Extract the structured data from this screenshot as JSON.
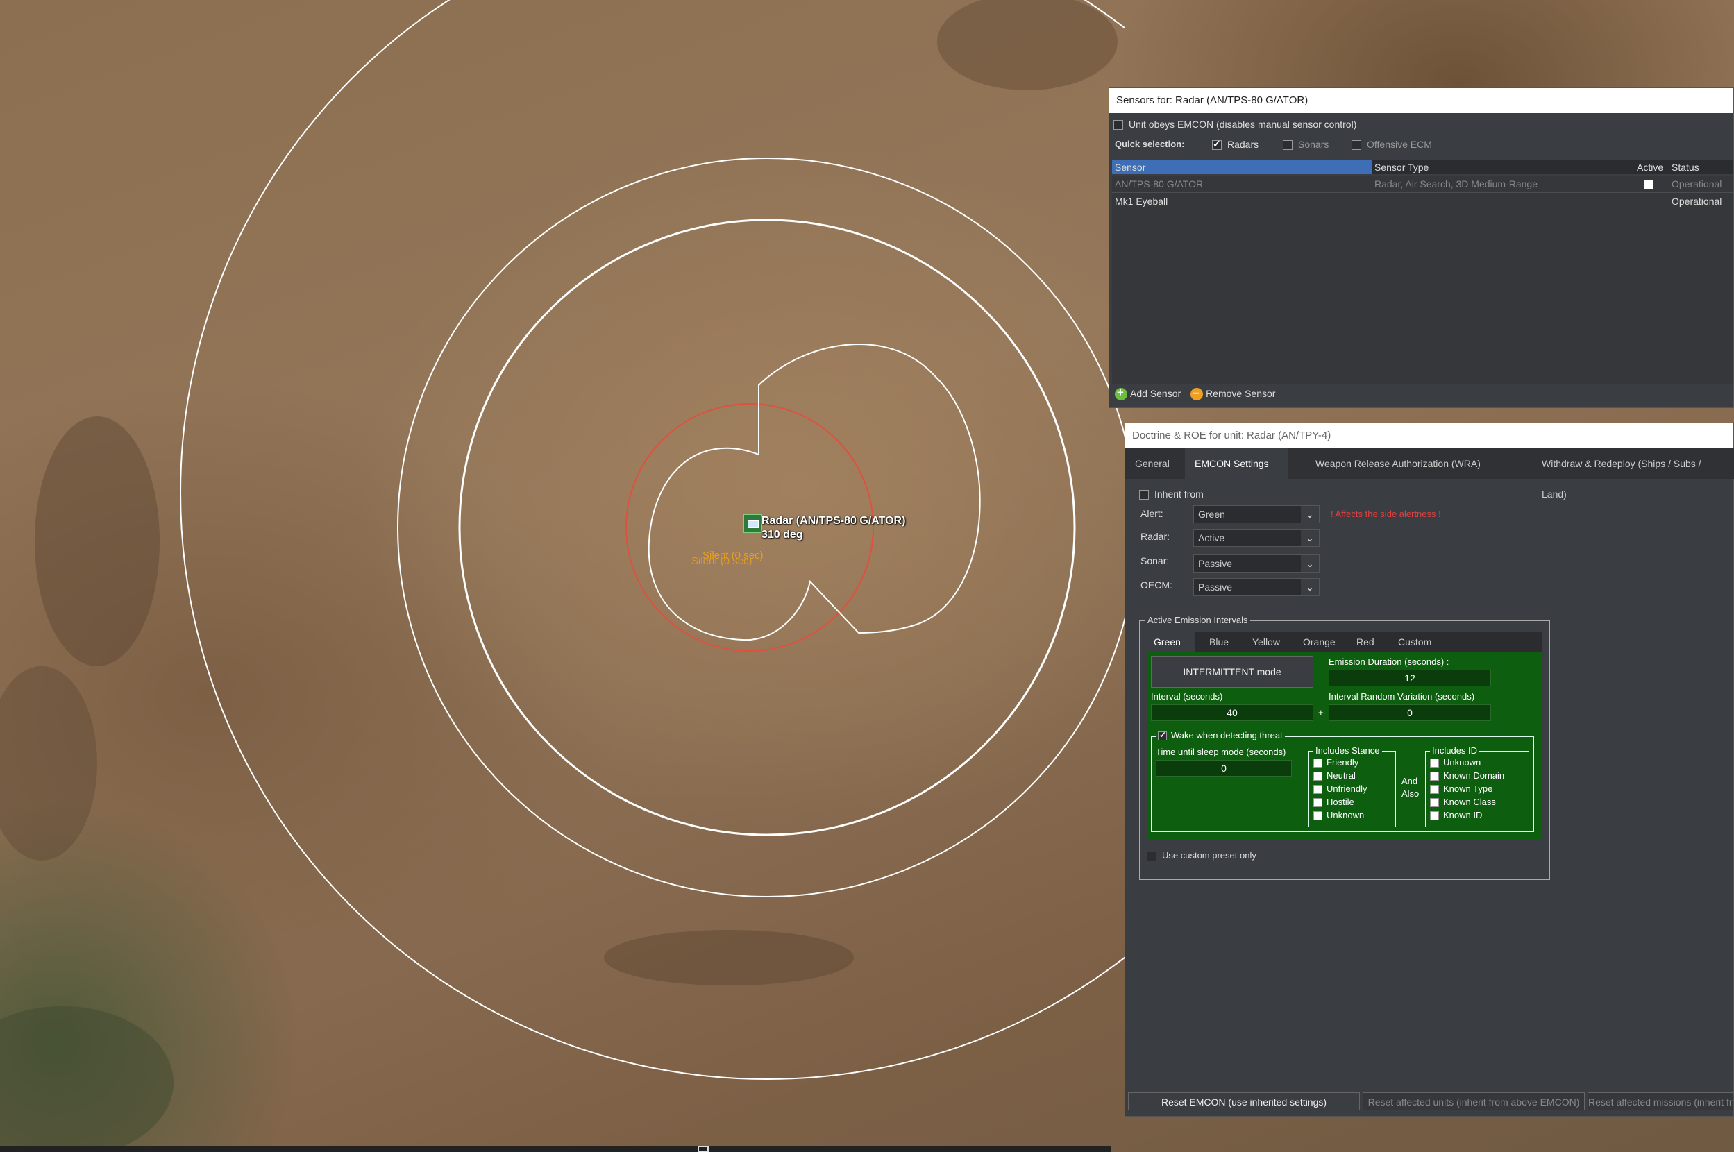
{
  "map": {
    "unit_label": "Radar (AN/TPS-80 G/ATOR)",
    "unit_heading": "310 deg",
    "silent_label_1": "Silent (0 sec)",
    "silent_label_2": "Silent (0 sec)",
    "ring_colors": {
      "range": "#ffffff",
      "arc": "#e05040"
    }
  },
  "sensors_window": {
    "title": "Sensors for: Radar (AN/TPS-80 G/ATOR)",
    "emcon_checkbox_label": "Unit obeys EMCON (disables manual sensor control)",
    "emcon_checked": false,
    "quick_selection_label": "Quick selection:",
    "quick": [
      {
        "label": "Radars",
        "checked": true
      },
      {
        "label": "Sonars",
        "checked": false
      },
      {
        "label": "Offensive ECM",
        "checked": false
      }
    ],
    "columns": {
      "sensor": "Sensor",
      "type": "Sensor Type",
      "active": "Active",
      "status": "Status"
    },
    "rows": [
      {
        "sensor": "AN/TPS-80 G/ATOR",
        "type": "Radar, Air Search, 3D Medium-Range",
        "active": true,
        "status": "Operational"
      },
      {
        "sensor": "Mk1 Eyeball",
        "type": "",
        "active": null,
        "status": "Operational"
      }
    ],
    "add_sensor": "Add Sensor",
    "remove_sensor": "Remove Sensor"
  },
  "doctrine_window": {
    "title": "Doctrine & ROE for unit: Radar (AN/TPY-4)",
    "tabs": [
      "General",
      "EMCON Settings",
      "Weapon Release Authorization (WRA)",
      "Withdraw & Redeploy (Ships / Subs / Land)"
    ],
    "active_tab": "EMCON Settings",
    "inherit_from_label": "Inherit from",
    "inherit_checked": false,
    "alert_label": "Alert:",
    "alert_value": "Green",
    "alert_warning": "! Affects the side alertness !",
    "radar_label": "Radar:",
    "radar_value": "Active",
    "sonar_label": "Sonar:",
    "sonar_value": "Passive",
    "oecm_label": "OECM:",
    "oecm_value": "Passive",
    "aei_label": "Active Emission Intervals",
    "color_tabs": [
      "Green",
      "Blue",
      "Yellow",
      "Orange",
      "Red",
      "Custom"
    ],
    "active_color_tab": "Green",
    "mode_button": "INTERMITTENT mode",
    "emission_duration_label": "Emission Duration (seconds) :",
    "emission_duration_value": "12",
    "interval_label": "Interval (seconds)",
    "interval_value": "40",
    "plus_sign": "+",
    "interval_random_label": "Interval Random Variation (seconds)",
    "interval_random_value": "0",
    "wake_label": "Wake when detecting threat",
    "wake_checked": true,
    "sleep_label": "Time until sleep mode (seconds)",
    "sleep_value": "0",
    "stance_label": "Includes Stance",
    "stance": [
      {
        "label": "Friendly",
        "checked": false
      },
      {
        "label": "Neutral",
        "checked": true
      },
      {
        "label": "Unfriendly",
        "checked": true
      },
      {
        "label": "Hostile",
        "checked": true
      },
      {
        "label": "Unknown",
        "checked": true
      }
    ],
    "and_label": "And",
    "also_label": "Also",
    "id_label": "Includes ID",
    "ids": [
      {
        "label": "Unknown",
        "checked": true
      },
      {
        "label": "Known Domain",
        "checked": true
      },
      {
        "label": "Known Type",
        "checked": true
      },
      {
        "label": "Known Class",
        "checked": true
      },
      {
        "label": "Known ID",
        "checked": true
      }
    ],
    "custom_preset_label": "Use custom preset only",
    "custom_preset_checked": false,
    "reset_emcon": "Reset EMCON (use inherited settings)",
    "reset_units": "Reset affected units (inherit from above EMCON)",
    "reset_missions": "Reset affected missions (inherit from above EMCON)"
  }
}
